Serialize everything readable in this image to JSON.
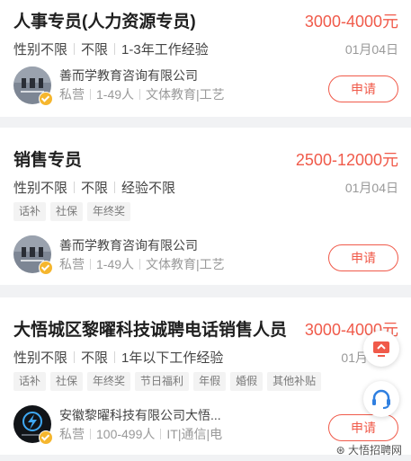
{
  "jobs": [
    {
      "title": "人事专员(人力资源专员)",
      "salary": "3000-4000元",
      "requirements": [
        "性别不限",
        "不限",
        "1-3年工作经验"
      ],
      "date": "01月04日",
      "tags": [],
      "company": "善而学教育咨询有限公司",
      "meta": [
        "私营",
        "1-49人",
        "文体教育|工艺"
      ],
      "apply_label": "申请"
    },
    {
      "title": "销售专员",
      "salary": "2500-12000元",
      "requirements": [
        "性别不限",
        "不限",
        "经验不限"
      ],
      "date": "01月04日",
      "tags": [
        "话补",
        "社保",
        "年终奖"
      ],
      "company": "善而学教育咨询有限公司",
      "meta": [
        "私营",
        "1-49人",
        "文体教育|工艺"
      ],
      "apply_label": "申请"
    },
    {
      "title": "大悟城区黎曜科技诚聘电话销售人员",
      "salary": "3000-4000元",
      "requirements": [
        "性别不限",
        "不限",
        "1年以下工作经验"
      ],
      "date": "01月",
      "tags": [
        "话补",
        "社保",
        "年终奖",
        "节日福利",
        "年假",
        "婚假",
        "其他补贴"
      ],
      "company": "安徽黎曜科技有限公司大悟...",
      "meta": [
        "私营",
        "100-499人",
        "IT|通信|电"
      ],
      "apply_label": "申请"
    }
  ],
  "floating": {
    "first_icon": "monitor-icon",
    "second_icon": "headset-icon",
    "accent": "#f05a4a",
    "blue": "#2f7fe0"
  },
  "watermark": "大悟招聘网"
}
